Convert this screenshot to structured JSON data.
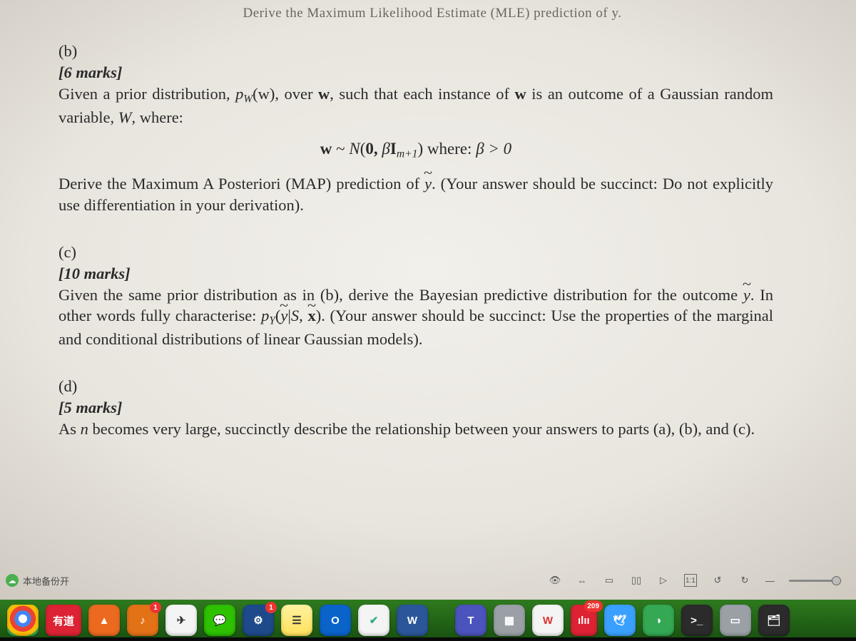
{
  "truncated_header": "Derive the Maximum Likelihood Estimate (MLE) prediction of y.",
  "questions": {
    "b": {
      "label": "(b)",
      "marks": "[6 marks]",
      "p1_pre": "Given a prior distribution, ",
      "p1_pw": "p",
      "p1_pw_sub": "W",
      "p1_arg": "(w)",
      "p1_mid": ", over ",
      "p1_w": "w",
      "p1_post": ", such that each instance of ",
      "p1_w2": "w",
      "p1_tail": " is an outcome of a Gaussian random variable, ",
      "p1_W": "W",
      "p1_end": ", where:",
      "eq_w": "w",
      "eq_tilde": " ~ ",
      "eq_N": "N",
      "eq_open": "(",
      "eq_zero": "0, ",
      "eq_beta": "β",
      "eq_I": "I",
      "eq_I_sub": "m+1",
      "eq_close": ")   where:  ",
      "eq_cond": "β > 0",
      "p2_pre": "Derive the Maximum A Posteriori (MAP) prediction of ",
      "p2_y": "y",
      "p2_post": ".  (Your answer should be succinct: Do not explicitly use differentiation in your derivation)."
    },
    "c": {
      "label": "(c)",
      "marks": "[10 marks]",
      "t1": "Given the same prior distribution as in (b), derive the Bayesian predictive distribution for the outcome ",
      "y": "y",
      "t2": ". In other words fully characterise: ",
      "pY": "p",
      "pY_sub": "Y",
      "arg_open": "(",
      "arg_y": "y",
      "arg_bar": "|",
      "arg_S": "S",
      "arg_comma": ", ",
      "arg_x": "x",
      "arg_close": ")",
      "t3": ". (Your answer should be succinct: Use the properties of the marginal and conditional distributions of linear Gaussian models)."
    },
    "d": {
      "label": "(d)",
      "marks": "[5 marks]",
      "t1": "As ",
      "n": "n",
      "t2": " becomes very large, succinctly describe the relationship between your answers to parts (a), (b), and (c)."
    }
  },
  "status": {
    "backup": "本地备份开",
    "zoom": "1:1"
  },
  "dock": {
    "youdao": "有道",
    "music_badge": "1",
    "word": "W",
    "outlook": "O",
    "teams": "T",
    "wolfram": "W",
    "iliji": "ılıı",
    "iliji_badge": "209",
    "terminal": ">_"
  }
}
